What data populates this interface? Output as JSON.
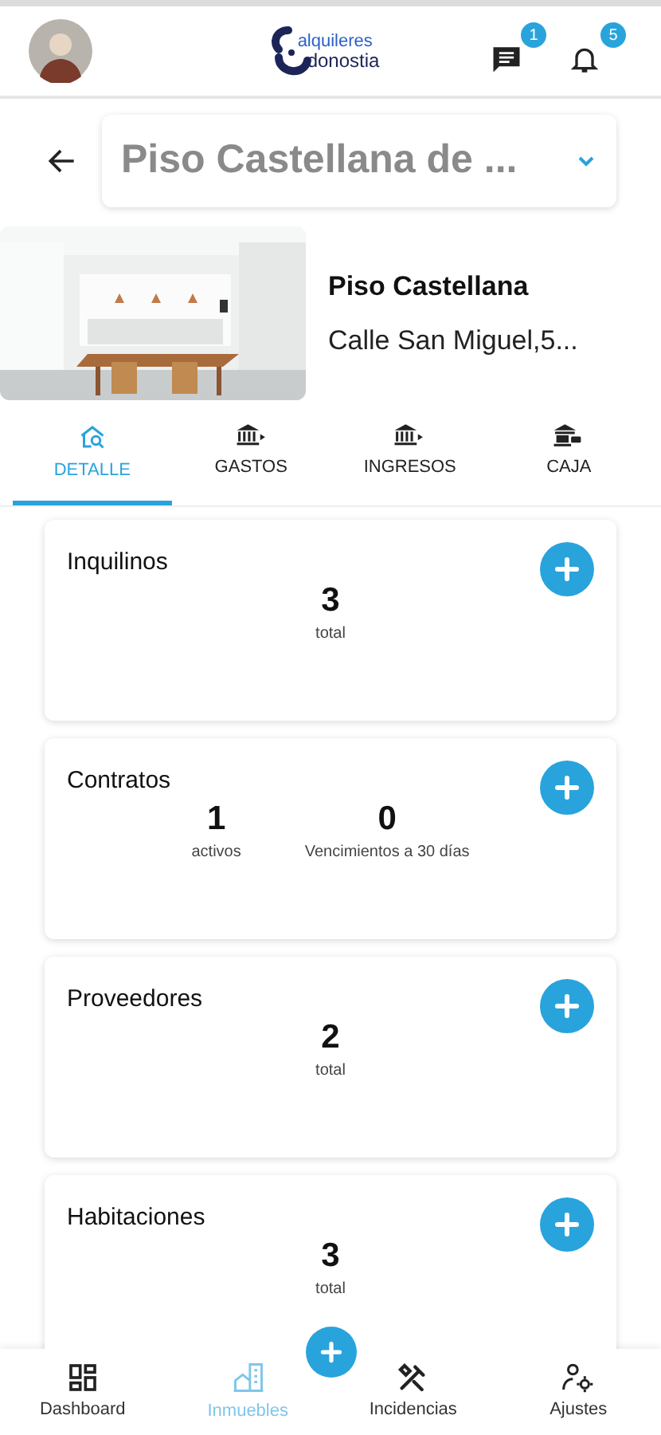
{
  "header": {
    "logo_top": "alquileres",
    "logo_bottom": "donostia",
    "messages_badge": "1",
    "notifications_badge": "5"
  },
  "property_select": {
    "value": "Piso Castellana de ..."
  },
  "property": {
    "name": "Piso Castellana",
    "address": "Calle San Miguel,5..."
  },
  "tabs": [
    {
      "label": "DETALLE",
      "kind": "detail",
      "selected": true
    },
    {
      "label": "GASTOS",
      "kind": "bank-out",
      "selected": false
    },
    {
      "label": "INGRESOS",
      "kind": "bank-in",
      "selected": false
    },
    {
      "label": "CAJA",
      "kind": "cash",
      "selected": false
    }
  ],
  "cards": [
    {
      "title": "Inquilinos",
      "stats": [
        {
          "value": "3",
          "label": "total"
        }
      ]
    },
    {
      "title": "Contratos",
      "stats": [
        {
          "value": "1",
          "label": "activos"
        },
        {
          "value": "0",
          "label": "Vencimientos a 30 días"
        }
      ]
    },
    {
      "title": "Proveedores",
      "stats": [
        {
          "value": "2",
          "label": "total"
        }
      ]
    },
    {
      "title": "Habitaciones",
      "stats": [
        {
          "value": "3",
          "label": "total"
        }
      ]
    }
  ],
  "bottom_nav": [
    {
      "label": "Dashboard",
      "kind": "dashboard",
      "selected": false
    },
    {
      "label": "Inmuebles",
      "kind": "building",
      "selected": true
    },
    {
      "label": "Incidencias",
      "kind": "tools",
      "selected": false
    },
    {
      "label": "Ajustes",
      "kind": "user-settings",
      "selected": false
    }
  ]
}
